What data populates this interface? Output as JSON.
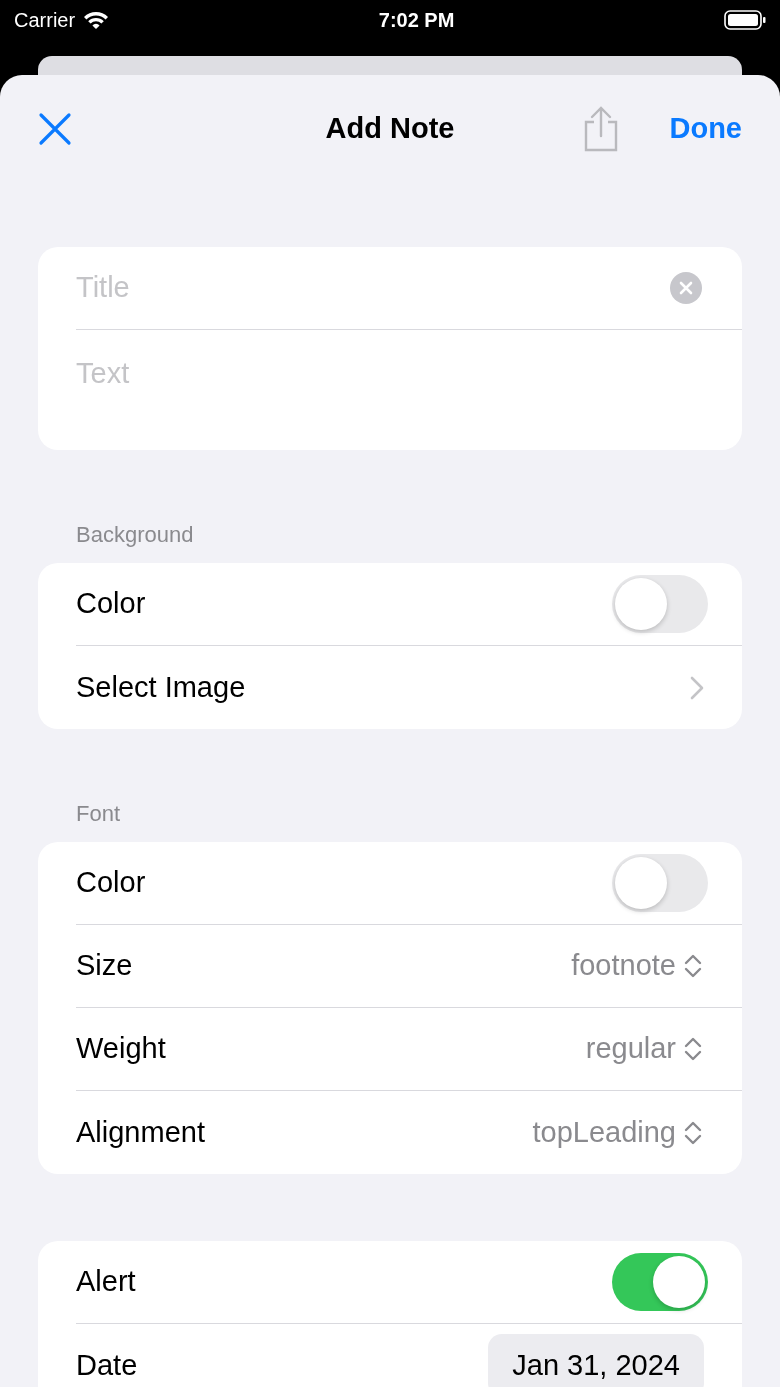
{
  "status_bar": {
    "carrier": "Carrier",
    "time": "7:02 PM"
  },
  "nav": {
    "title": "Add Note",
    "done": "Done"
  },
  "fields": [
    {
      "kind": "single",
      "placeholder": "Title"
    },
    {
      "kind": "multi",
      "placeholder": "Text"
    }
  ],
  "sections": [
    {
      "header": "Background",
      "rows": [
        {
          "kind": "toggle",
          "label": "Color",
          "on": false
        },
        {
          "kind": "link",
          "label": "Select Image"
        }
      ]
    },
    {
      "header": "Font",
      "rows": [
        {
          "kind": "toggle",
          "label": "Color",
          "on": false
        },
        {
          "kind": "picker",
          "label": "Size",
          "value": "footnote"
        },
        {
          "kind": "picker",
          "label": "Weight",
          "value": "regular"
        },
        {
          "kind": "picker",
          "label": "Alignment",
          "value": "topLeading"
        }
      ]
    },
    {
      "rows": [
        {
          "kind": "toggle",
          "label": "Alert",
          "on": true
        },
        {
          "kind": "date",
          "label": "Date",
          "value": "Jan 31, 2024"
        }
      ]
    }
  ]
}
